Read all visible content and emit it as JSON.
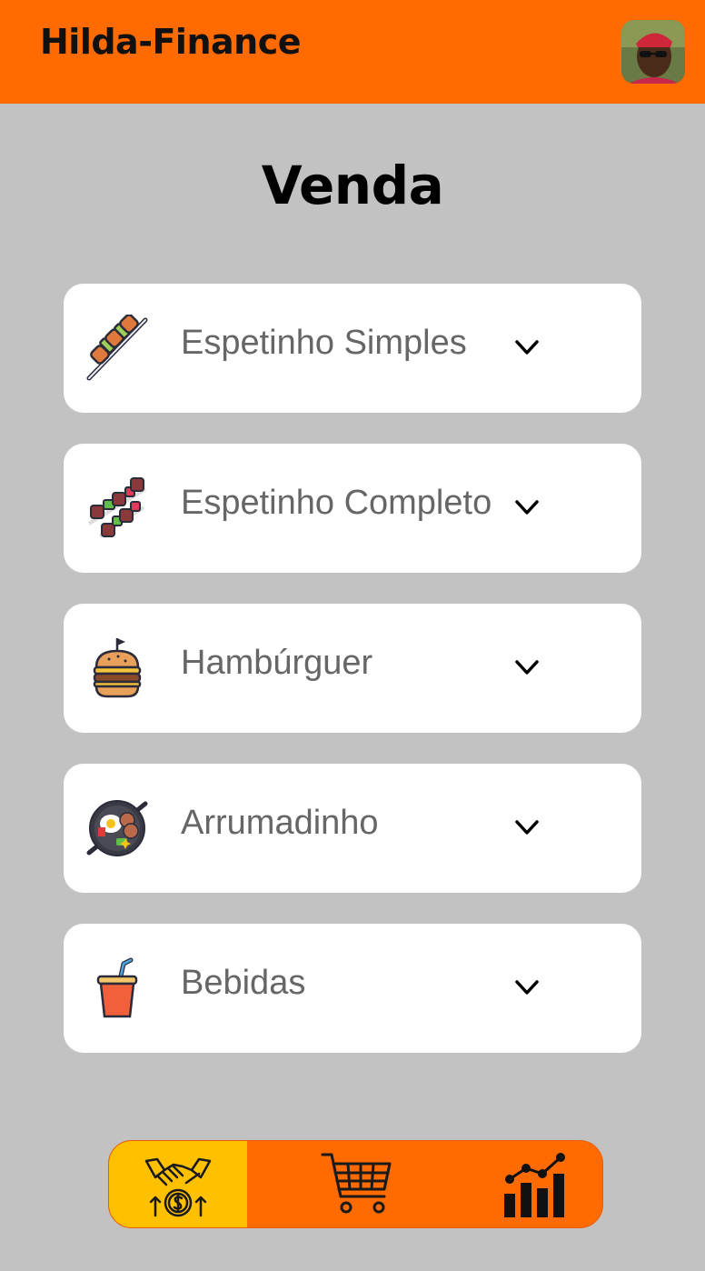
{
  "header": {
    "app_title": "Hilda-Finance",
    "avatar_icon": "user-avatar",
    "background_color": "#ff6b00"
  },
  "main": {
    "title": "Venda",
    "categories": [
      {
        "label": "Espetinho Simples",
        "icon": "skewer-icon"
      },
      {
        "label": "Espetinho Completo",
        "icon": "double-skewer-icon"
      },
      {
        "label": "Hambúrguer",
        "icon": "burger-icon"
      },
      {
        "label": "Arrumadinho",
        "icon": "food-pan-icon"
      },
      {
        "label": "Bebidas",
        "icon": "drink-cup-icon"
      }
    ],
    "expand_icon": "chevron-down-icon"
  },
  "bottom_nav": {
    "items": [
      {
        "icon": "sales-handshake-icon",
        "active": true
      },
      {
        "icon": "shopping-cart-icon",
        "active": false
      },
      {
        "icon": "bar-chart-icon",
        "active": false
      }
    ],
    "active_color": "#ffc000",
    "background_color": "#ff6b00"
  }
}
